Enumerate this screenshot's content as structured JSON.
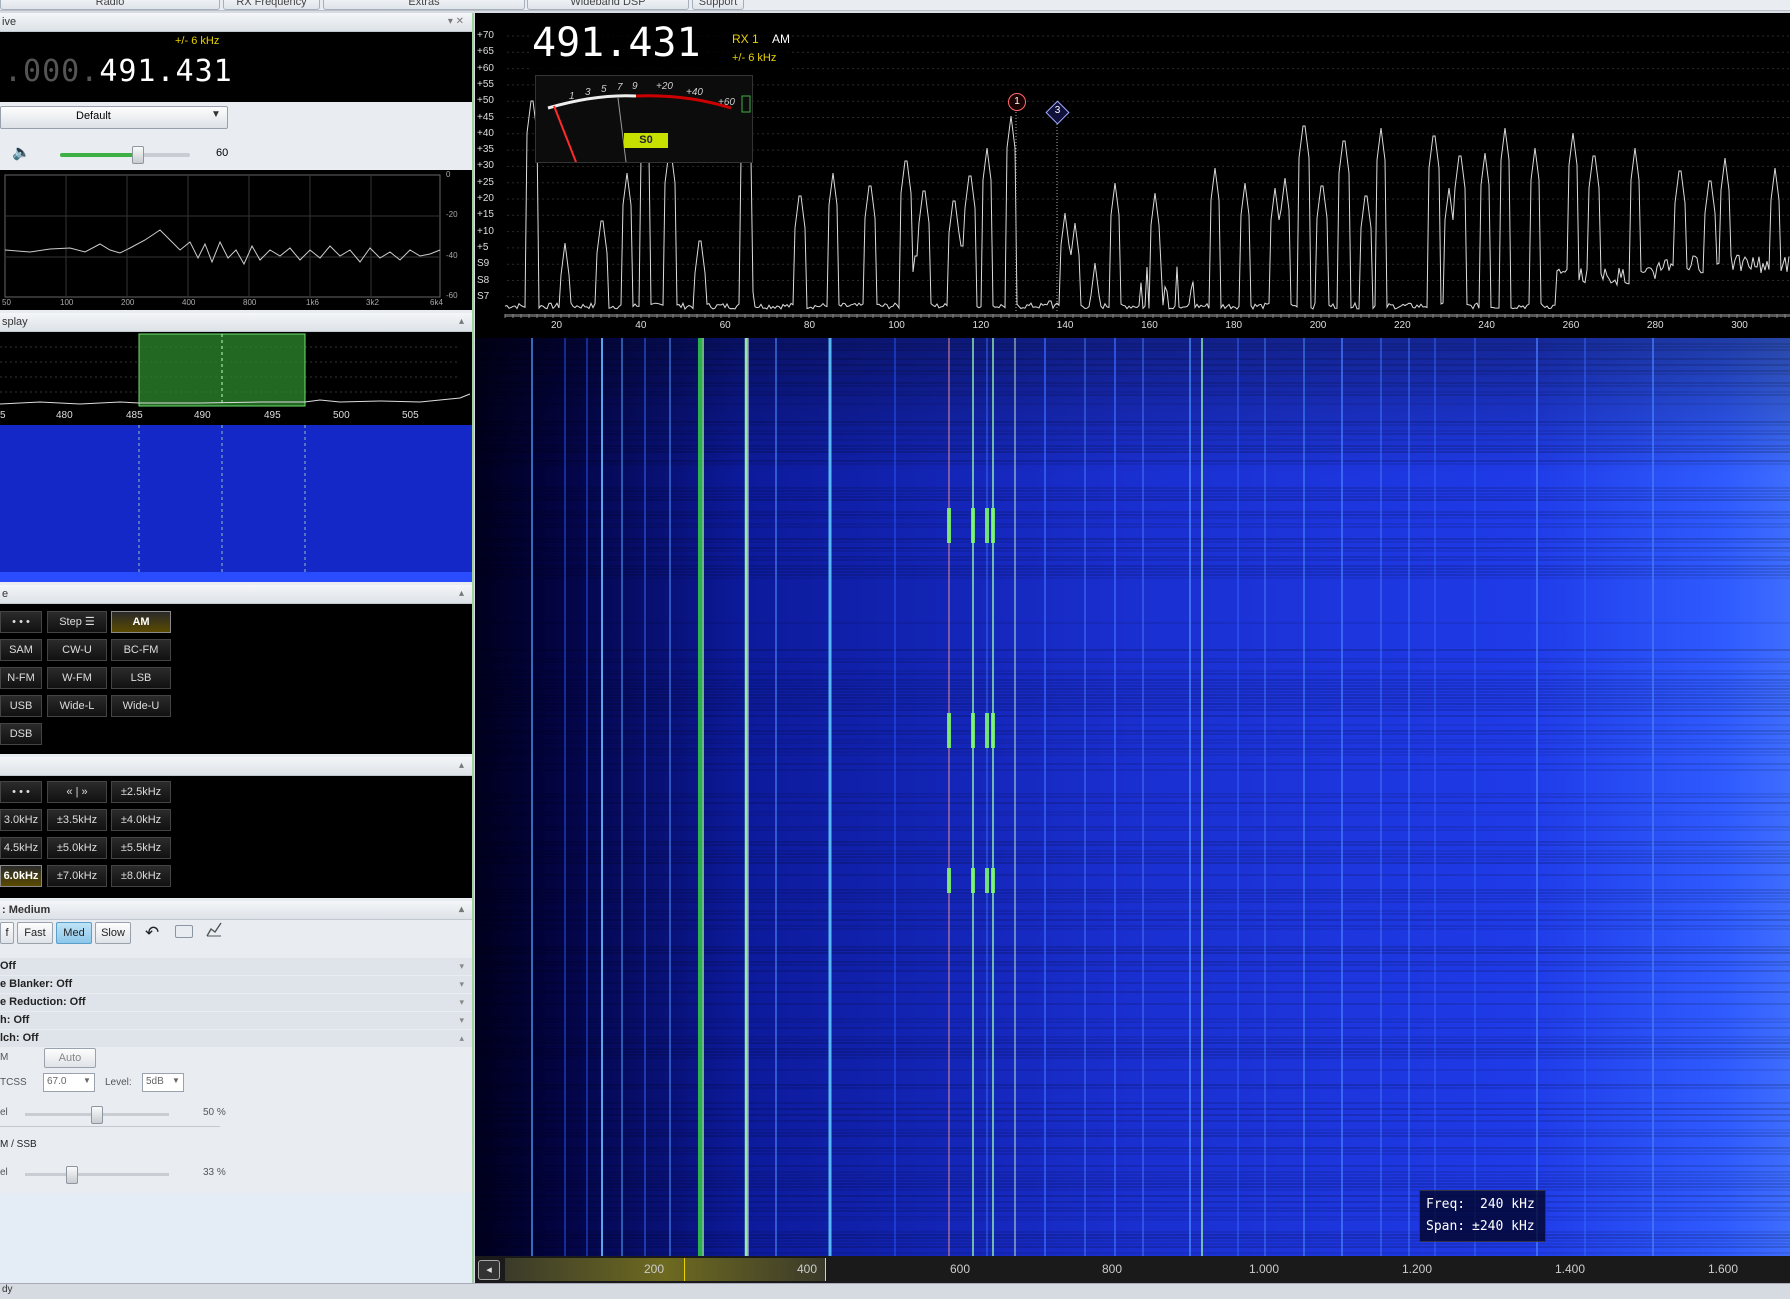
{
  "menu": {
    "tabs": [
      "Radio",
      "RX Frequency",
      "Extras",
      "Wideband DSP",
      "Support"
    ]
  },
  "left": {
    "receive_title": "ive",
    "bandwidth_label": "+/- 6 kHz",
    "freq_dim": ".000.",
    "freq_main": "491.431",
    "preset": "Default",
    "volume_value": "60",
    "audio_y": [
      "0",
      "-20",
      "-40",
      "-60"
    ],
    "audio_x": [
      "50",
      "100",
      "200",
      "400",
      "800",
      "1k6",
      "3k2",
      "6k4"
    ],
    "display_title": "splay",
    "display_x": [
      "5",
      "480",
      "485",
      "490",
      "495",
      "500",
      "505"
    ],
    "mode_title": "e",
    "mode_buttons": [
      "• • •",
      "Step ☰",
      "AM",
      "SAM",
      "CW-U",
      "BC-FM",
      "N-FM",
      "W-FM",
      "LSB",
      "USB",
      "Wide-L",
      "Wide-U",
      "DSB"
    ],
    "filter_buttons": [
      "• • •",
      "« | »",
      "±2.5kHz",
      "3.0kHz",
      "±3.5kHz",
      "±4.0kHz",
      "4.5kHz",
      "±5.0kHz",
      "±5.5kHz",
      "6.0kHz",
      "±7.0kHz",
      "±8.0kHz"
    ],
    "agc_title": ": Medium",
    "agc_buttons": [
      "f",
      "Fast",
      "Med",
      "Slow"
    ],
    "rows": [
      "Off",
      "e Blanker: Off",
      "e Reduction: Off",
      "h: Off",
      "lch: Off"
    ],
    "squelch": {
      "m_label": "M",
      "auto": "Auto",
      "ctcss_label": "TCSS",
      "ctcss_value": "67.0",
      "level_label": "Level:",
      "level_value": "5dB",
      "el_label": "el",
      "el_value": "50 %",
      "ssb_title": "M / SSB",
      "ssb_el_label": "el",
      "ssb_el_value": "33 %"
    },
    "status_text": "dy"
  },
  "spectrum": {
    "freq": "491.431",
    "rx": "RX 1",
    "mode": "AM",
    "bw": "+/- 6 kHz",
    "smeter_scale": [
      "1",
      "3",
      "5",
      "7",
      "9",
      "+20",
      "+40",
      "+60"
    ],
    "smeter_value": "S0",
    "y_labels": [
      "+70",
      "+65",
      "+60",
      "+55",
      "+50",
      "+45",
      "+40",
      "+35",
      "+30",
      "+25",
      "+20",
      "+15",
      "+10",
      "+5",
      "S9",
      "S8",
      "S7"
    ],
    "x_labels": [
      "20",
      "40",
      "60",
      "80",
      "100",
      "120",
      "140",
      "160",
      "180",
      "200",
      "220",
      "240",
      "260",
      "280",
      "300"
    ],
    "marker1": "1",
    "marker3": "3"
  },
  "waterfall": {
    "freq_label": "Freq:",
    "freq_value": "240 kHz",
    "span_label": "Span:",
    "span_value": "±240 kHz"
  },
  "bottom": {
    "labels": [
      "200",
      "400",
      "600",
      "800",
      "1.000",
      "1.200",
      "1.400",
      "1.600"
    ]
  },
  "colors": {
    "accent": "#e8d200",
    "spectrum_bg": "#000000",
    "waterfall": "#1a2fd8"
  }
}
